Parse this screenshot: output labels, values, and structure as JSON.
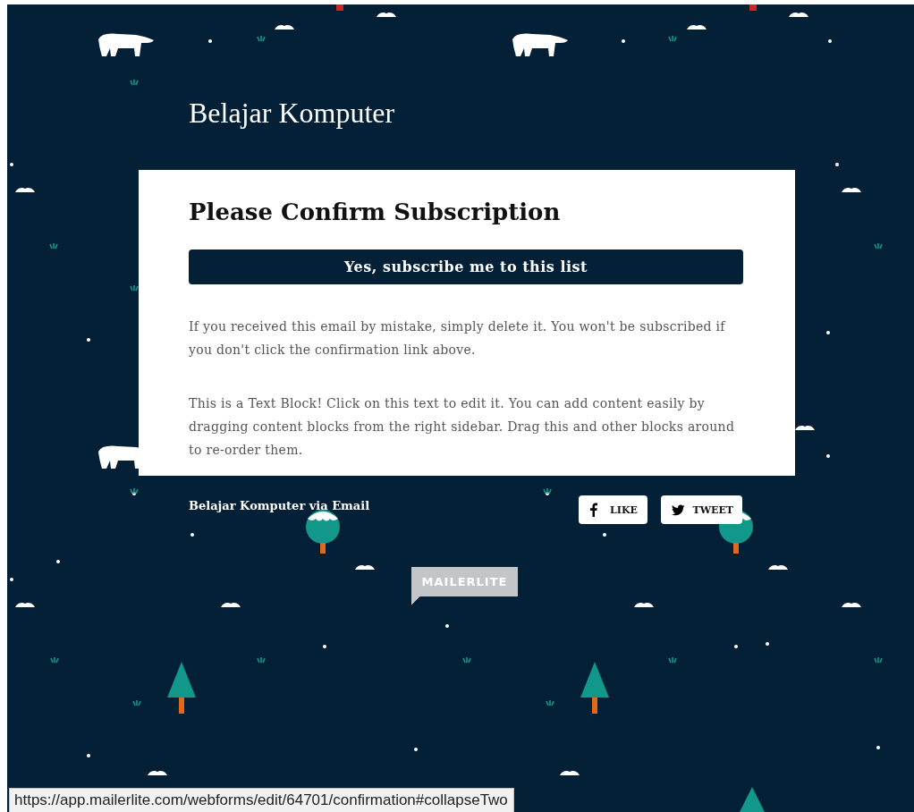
{
  "header": {
    "title": "Belajar Komputer"
  },
  "card": {
    "heading": "Please Confirm Subscription",
    "button": "Yes, subscribe me to this list",
    "paragraphs": [
      "If you received this email by mistake, simply delete it. You won't be subscribed if you don't click the confirmation link above.",
      "This is a Text Block! Click on this text to edit it. You can add content easily by dragging content blocks from the right sidebar. Drag this and other blocks around to re-order them."
    ]
  },
  "footer": {
    "text": "Belajar Komputer via Email",
    "share_buttons": [
      {
        "kind": "facebook",
        "label": "LIKE"
      },
      {
        "kind": "twitter",
        "label": "TWEET"
      }
    ]
  },
  "badge": {
    "label": "MAILERLITE"
  },
  "status_bar": {
    "url": "https://app.mailerlite.com/webforms/edit/64701/confirmation#collapseTwo"
  }
}
